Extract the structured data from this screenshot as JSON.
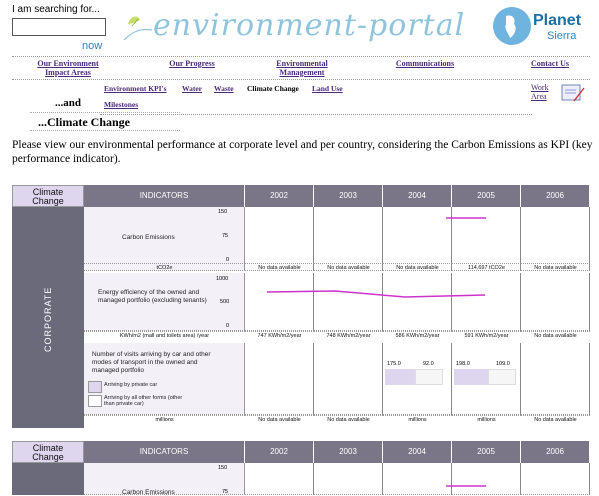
{
  "search": {
    "label": "I am searching for...",
    "placeholder": "",
    "button": "now"
  },
  "logo": {
    "text": "environment-portal"
  },
  "brand": {
    "name": "Planet",
    "sub": "Sierra"
  },
  "nav": [
    "Our Environment\nImpact Areas",
    "Our Progress",
    "Environmental\nManagement",
    "Communications",
    "Contact Us"
  ],
  "subnav": {
    "items": [
      "Environment KPI's",
      "Water",
      "Waste",
      "Climate Change",
      "Land Use"
    ],
    "milestones": "Milestones",
    "and": "...and",
    "title": "...Climate Change",
    "workarea": "Work\nArea"
  },
  "intro": "Please view our environmental performance at corporate level and per country, considering the Carbon Emissions as KPI (key performance indicator).",
  "table": {
    "corner": "Climate\nChange",
    "indicators": "INDICATORS",
    "years": [
      "2002",
      "2003",
      "2004",
      "2005",
      "2006"
    ],
    "sidebar": "CORPORATE",
    "rows": [
      {
        "name": "Carbon Emissions",
        "unit": "tCO2e",
        "axis": [
          "150",
          "75",
          "0"
        ],
        "cells": [
          "No data available",
          "No data available",
          "No data available",
          "114,697 tCO2e",
          "No data available"
        ]
      },
      {
        "name": "Energy efficiency of the owned and managed portfolio (excluding tenants)",
        "unit": "KWh/m2 (mall and toilets area) /year",
        "axis": [
          "1000",
          "500",
          "0"
        ],
        "cells": [
          "747 KWh/m2/year",
          "748 KWh/m2/year",
          "586 KWh/m2/year",
          "591 KWh/m2/year",
          "No data available"
        ]
      },
      {
        "name": "Number of visits arriving by car and other modes of transport in the owned and managed portfolio",
        "unit": "millions",
        "legend": [
          "Arriving by private car",
          "Arriving by all other forms (other than private car)"
        ],
        "values": {
          "2004": [
            "175.0",
            "92.0"
          ],
          "2005": [
            "198.0",
            "109.0"
          ]
        },
        "cells": [
          "No data available",
          "No data available",
          "millions",
          "millions",
          "No data available"
        ]
      }
    ],
    "second": {
      "axis": [
        "150",
        "75"
      ],
      "name": "Carbon Emissions"
    }
  },
  "colors": {
    "accent": "#cc33cc",
    "header": "#7a7587",
    "sidebar": "#6b6a7a"
  }
}
